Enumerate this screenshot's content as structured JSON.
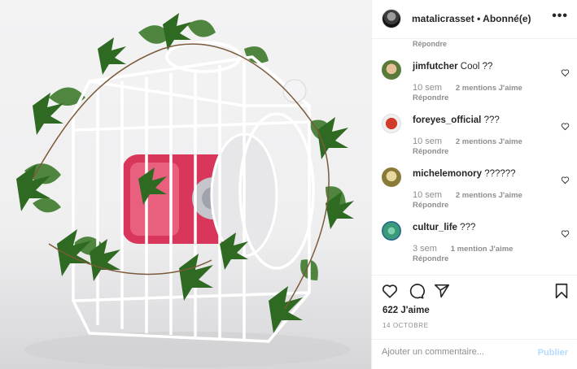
{
  "header": {
    "username": "matalicrasset",
    "separator": "•",
    "follow_status": "Abonné(e)",
    "more_icon": "more-horizontal-icon"
  },
  "comments": {
    "reply_top": "Répondre",
    "items": [
      {
        "user": "jimfutcher",
        "text": "Cool ??",
        "time": "10 sem",
        "likes": "2 mentions J'aime",
        "reply": "Répondre",
        "avatar_color": "#6b8e6b"
      },
      {
        "user": "foreyes_official",
        "text": "???",
        "time": "10 sem",
        "likes": "2 mentions J'aime",
        "reply": "Répondre",
        "avatar_color": "#d23a2a"
      },
      {
        "user": "michelemonory",
        "text": "??????",
        "time": "10 sem",
        "likes": "2 mentions J'aime",
        "reply": "Répondre",
        "avatar_color": "#8a7a3a"
      },
      {
        "user": "cultur_life",
        "text": "???",
        "time": "3 sem",
        "likes": "1 mention J'aime",
        "reply": "Répondre",
        "avatar_color": "#3a9a7a"
      }
    ]
  },
  "actions": {
    "icons": [
      "heart-icon",
      "comment-icon",
      "share-icon",
      "bookmark-icon"
    ],
    "likes": "622 J'aime",
    "date": "14 OCTOBRE"
  },
  "add_comment": {
    "placeholder": "Ajouter un commentaire...",
    "publish_label": "Publier"
  },
  "colors": {
    "text": "#262626",
    "secondary": "#8e8e8e",
    "publish_disabled": "#b3dbff",
    "border": "#efefef",
    "plant_green": "#3f7a2c",
    "speaker_pink": "#d8365a"
  }
}
